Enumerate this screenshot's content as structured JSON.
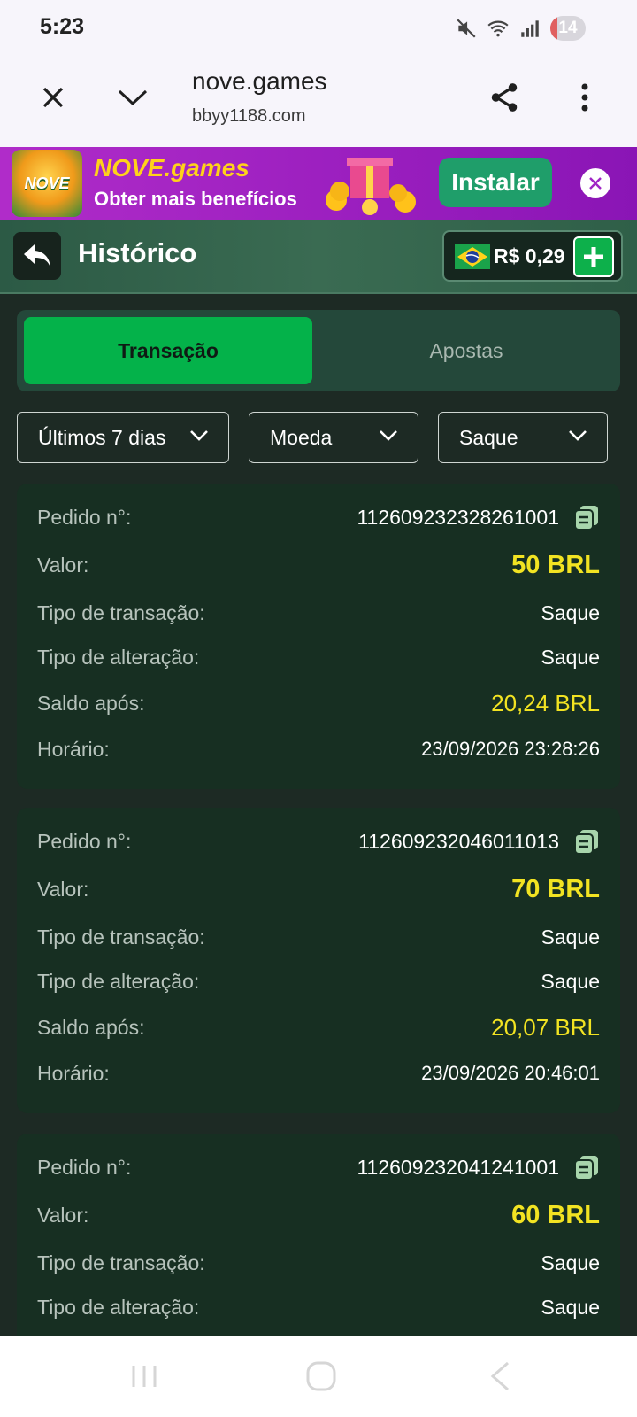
{
  "status_bar": {
    "time": "5:23",
    "battery": "14"
  },
  "browser": {
    "title": "nove.games",
    "url": "bbyy1188.com"
  },
  "banner": {
    "app_name": "NOVE.games",
    "subtitle": "Obter mais benefícios",
    "install_label": "Instalar",
    "logo_text": "NOVE"
  },
  "header": {
    "title": "Histórico",
    "balance": "R$ 0,29"
  },
  "tabs": [
    {
      "label": "Transação",
      "active": true
    },
    {
      "label": "Apostas",
      "active": false
    }
  ],
  "filters": {
    "period": "Últimos 7 dias",
    "currency": "Moeda",
    "type": "Saque"
  },
  "labels": {
    "order": "Pedido n°:",
    "value": "Valor:",
    "transaction_type": "Tipo de transação:",
    "change_type": "Tipo de alteração:",
    "balance_after": "Saldo após:",
    "time": "Horário:"
  },
  "transactions": [
    {
      "order": "112609232328261001",
      "value": "50 BRL",
      "transaction_type": "Saque",
      "change_type": "Saque",
      "balance_after": "20,24 BRL",
      "time": "23/09/2026 23:28:26"
    },
    {
      "order": "112609232046011013",
      "value": "70 BRL",
      "transaction_type": "Saque",
      "change_type": "Saque",
      "balance_after": "20,07 BRL",
      "time": "23/09/2026 20:46:01"
    },
    {
      "order": "112609232041241001",
      "value": "60 BRL",
      "transaction_type": "Saque",
      "change_type": "Saque",
      "balance_after": "",
      "time": ""
    }
  ],
  "colors": {
    "accent_green": "#04b24a",
    "money_yellow": "#f2e322",
    "card_bg": "#172f22",
    "banner_purple": "#a024c5"
  },
  "icons": [
    "close-icon",
    "chevron-down-icon",
    "share-icon",
    "more-vert-icon",
    "back-icon",
    "plus-icon",
    "copy-icon",
    "brazil-flag-icon"
  ]
}
